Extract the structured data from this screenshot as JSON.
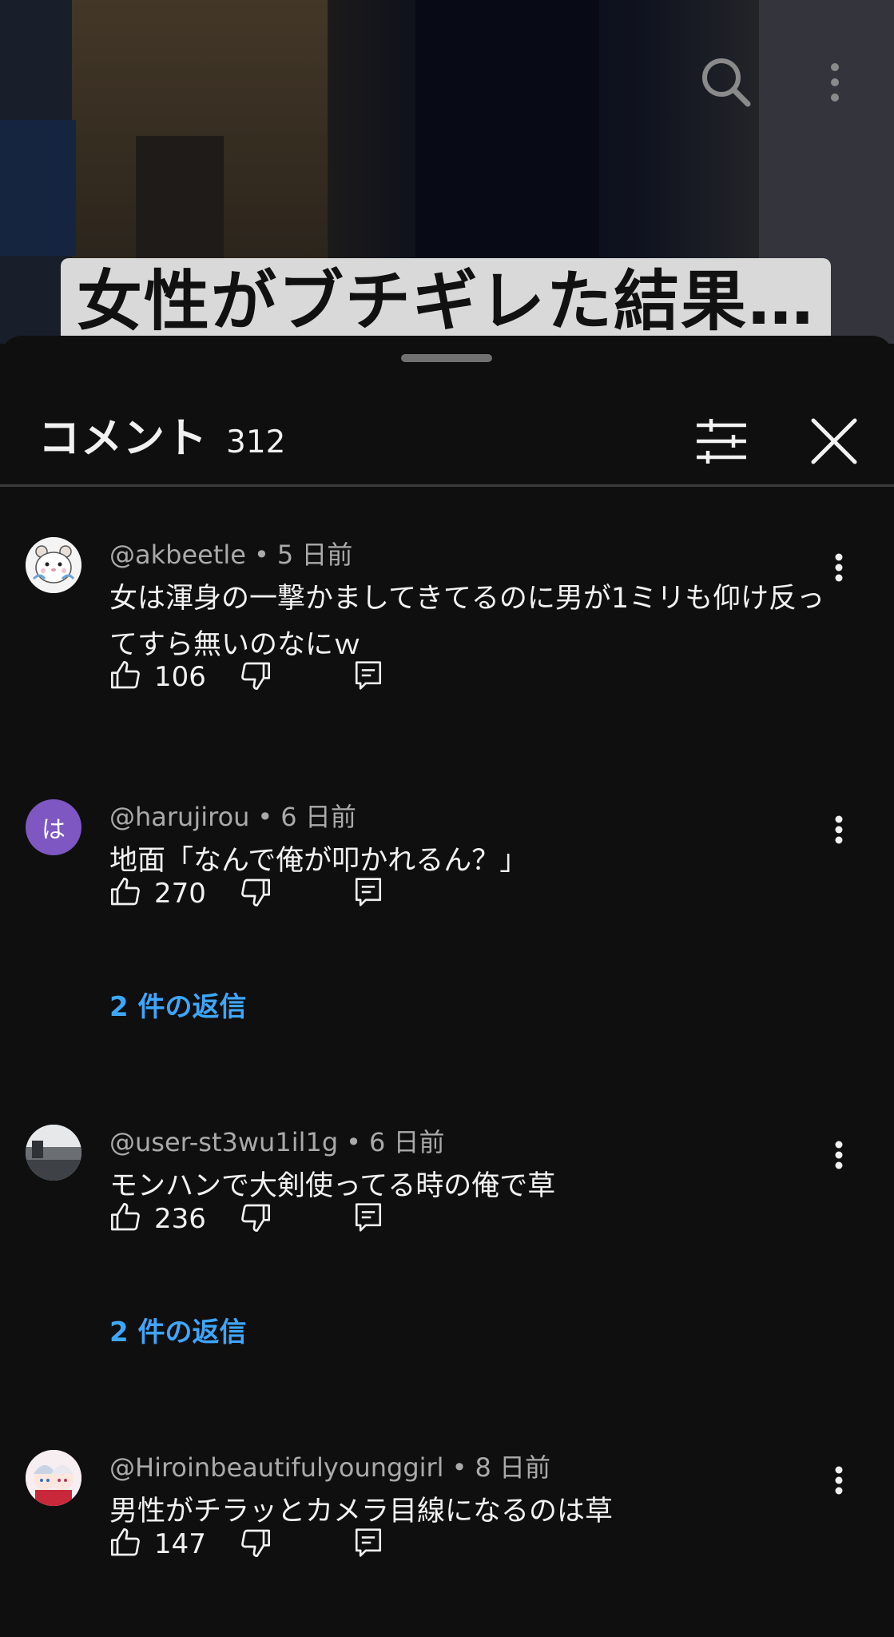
{
  "video": {
    "caption": "女性がブチギレた結果…",
    "icons": {
      "search": "search-icon",
      "more": "more-vert-icon"
    }
  },
  "panel": {
    "title": "コメント",
    "count": "312",
    "icons": {
      "filter": "sliders-icon",
      "close": "close-icon"
    }
  },
  "comments": [
    {
      "author": "@akbeetle",
      "time": "5 日前",
      "text": "女は渾身の一撃かましてきてるのに男が1ミリも仰け反ってすら無いのなにｗ",
      "likes": "106",
      "avatar": "hamster-avatar"
    },
    {
      "author": "@harujirou",
      "time": "6 日前",
      "text": "地面「なんで俺が叩かれるん？」",
      "likes": "270",
      "avatar_letter": "は",
      "avatar_color": "#7e57c2",
      "replies": "2 件の返信"
    },
    {
      "author": "@user-st3wu1il1g",
      "time": "6 日前",
      "text": "モンハンで大剣使ってる時の俺で草",
      "likes": "236",
      "avatar": "photo-avatar",
      "replies": "2 件の返信"
    },
    {
      "author": "@Hiroinbeautifulyounggirl",
      "time": "8 日前",
      "text": "男性がチラッとカメラ目線になるのは草",
      "likes": "147",
      "avatar": "anime-avatar"
    }
  ],
  "colors": {
    "background": "#0f0f0f",
    "link": "#3ea6ff",
    "meta": "#aaaaaa"
  }
}
